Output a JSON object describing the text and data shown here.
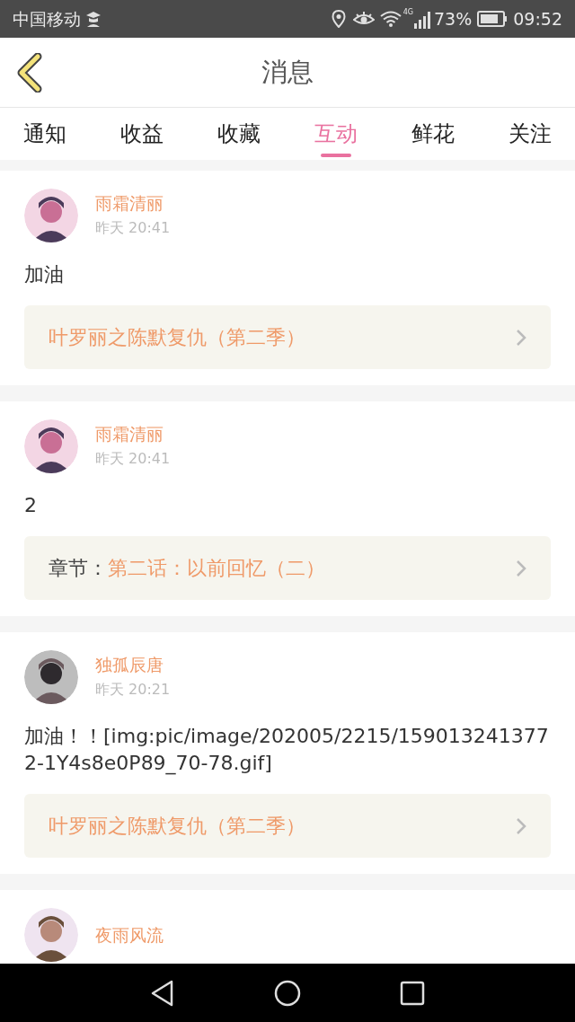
{
  "status_bar": {
    "carrier": "中国移动",
    "network": "4G",
    "battery": "73%",
    "time": "09:52"
  },
  "header": {
    "title": "消息"
  },
  "tabs": [
    {
      "label": "通知",
      "selected": false
    },
    {
      "label": "收益",
      "selected": false
    },
    {
      "label": "收藏",
      "selected": false
    },
    {
      "label": "互动",
      "selected": true
    },
    {
      "label": "鲜花",
      "selected": false
    },
    {
      "label": "关注",
      "selected": false
    }
  ],
  "messages": [
    {
      "user": "雨霜清丽",
      "time": "昨天 20:41",
      "text": "加油",
      "link": {
        "kind": "book",
        "title": "叶罗丽之陈默复仇（第二季）"
      }
    },
    {
      "user": "雨霜清丽",
      "time": "昨天 20:41",
      "text": "2",
      "link": {
        "kind": "chapter",
        "label": "章节：",
        "title": "第二话：以前回忆（二）"
      }
    },
    {
      "user": "独孤辰唐",
      "time": "昨天 20:21",
      "text": "加油！！[img:pic/image/202005/2215/1590132413772-1Y4s8e0P89_70-78.gif]",
      "link": {
        "kind": "book",
        "title": "叶罗丽之陈默复仇（第二季）"
      }
    },
    {
      "user": "夜雨风流"
    }
  ]
}
